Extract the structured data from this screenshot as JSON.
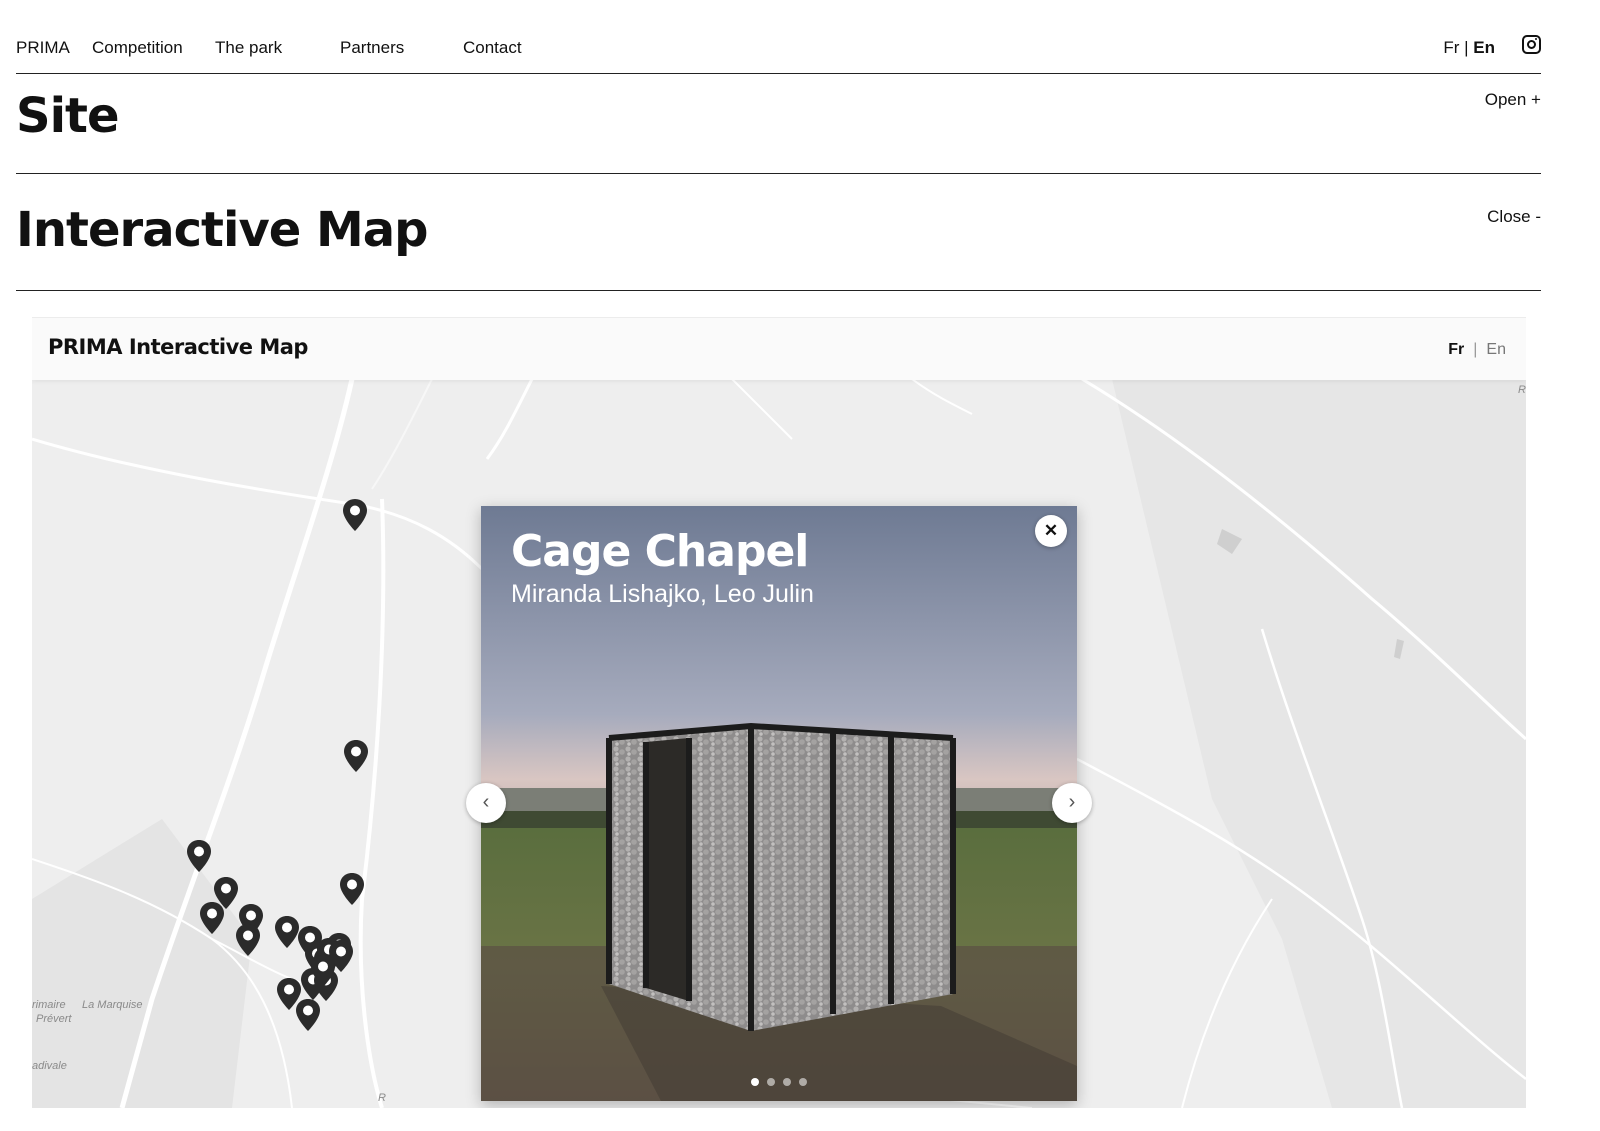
{
  "nav": {
    "brand": "PRIMA",
    "items": [
      "Competition",
      "The park",
      "Partners",
      "Contact"
    ],
    "lang_fr": "Fr",
    "lang_sep": "|",
    "lang_en": "En",
    "active_lang": "En",
    "instagram_icon": "instagram-icon"
  },
  "site_section": {
    "title": "Site",
    "toggle": "Open +"
  },
  "map_section": {
    "title": "Interactive Map",
    "toggle": "Close -"
  },
  "map_widget": {
    "title": "PRIMA Interactive Map",
    "lang_fr": "Fr",
    "lang_sep": "|",
    "lang_en": "En",
    "active_lang": "Fr",
    "map_labels": [
      "rimaire",
      "Prévert",
      "La Marquise",
      "adivale",
      "R",
      "R"
    ],
    "pin_count": 20
  },
  "popup": {
    "title": "Cage Chapel",
    "subtitle": "Miranda Lishajko, Leo Julin",
    "close_icon": "close-icon",
    "prev_icon": "chevron-left-icon",
    "next_icon": "chevron-right-icon",
    "close_glyph": "✕",
    "prev_glyph": "‹",
    "next_glyph": "›",
    "slide_count": 4,
    "active_slide": 1
  },
  "colors": {
    "map_bg": "#eeeeee",
    "road": "#ffffff",
    "pin": "#2b2b2b",
    "text": "#111111"
  }
}
